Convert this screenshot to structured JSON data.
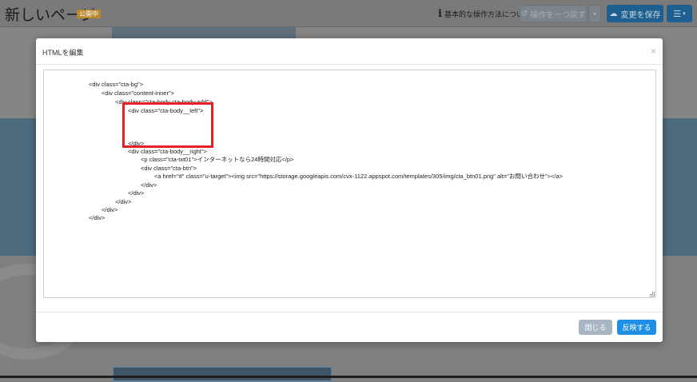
{
  "header": {
    "page_title": "新しいページ",
    "status_badge": "公開中",
    "help_link": "基本的な操作方法について",
    "undo_label": "操作を一つ戻す",
    "save_label": "変更を保存",
    "menu_icon": "hamburger-icon"
  },
  "modal": {
    "title": "HTMLを編集",
    "close_symbol": "×",
    "code_lines": [
      "<div class=\"cta-bg\">",
      "<div class=\"content-inner\">",
      "<div class=\"cta-body cta-body-add\">",
      "<div class=\"cta-body__left\">",
      "</div>",
      "<div class=\"cta-body__right\">",
      "<p class=\"cta-txt01\">インターネットなら24時間対応</p>",
      "<div class=\"cta-btn\">",
      "<a href=\"#\" class=\"u-target\"><img src=\"https://storage.googleapis.com/cvx-1122.appspot.com/templates/305/img/cta_btn01.png\" alt=\"お問い合わせ\"></a>",
      "</div>",
      "</div>",
      "</div>",
      "</div>",
      "</div>"
    ],
    "close_button": "閉じる",
    "apply_button": "反映する"
  },
  "colors": {
    "highlight": "#ea1f25",
    "primary": "#1f8fe5",
    "secondary": "#a7b6c2"
  }
}
